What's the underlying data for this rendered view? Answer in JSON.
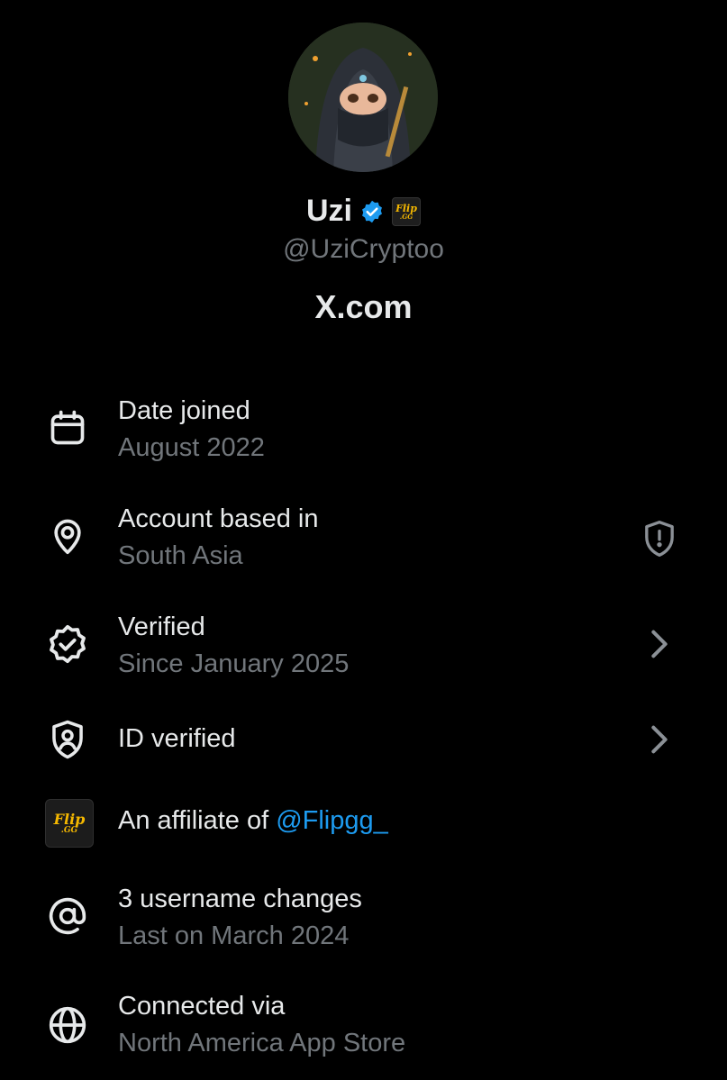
{
  "profile": {
    "display_name": "Uzi",
    "handle": "@UziCryptoo",
    "site": "X.com",
    "affiliate_badge_text": "Flip",
    "affiliate_badge_sub": ".GG",
    "verified_color": "#1d9bf0"
  },
  "rows": {
    "date_joined": {
      "title": "Date joined",
      "subtitle": "August 2022",
      "icon": "calendar-icon"
    },
    "account_based": {
      "title": "Account based in",
      "subtitle": "South Asia",
      "icon": "location-pin-icon",
      "right_icon": "shield-alert-icon"
    },
    "verified": {
      "title": "Verified",
      "subtitle": "Since January 2025",
      "icon": "verified-badge-outline-icon",
      "right_icon": "chevron-right-icon"
    },
    "id_verified": {
      "title": "ID verified",
      "icon": "id-shield-icon",
      "right_icon": "chevron-right-icon"
    },
    "affiliate": {
      "prefix": "An affiliate of ",
      "link": "@Flipgg_",
      "icon_text": "Flip",
      "icon_sub": ".GG"
    },
    "username_changes": {
      "title": "3 username changes",
      "subtitle": "Last on March 2024",
      "icon": "at-sign-icon"
    },
    "connected": {
      "title": "Connected via",
      "subtitle": "North America App Store",
      "icon": "globe-icon"
    }
  },
  "colors": {
    "background": "#000000",
    "primary_text": "#e7e9ea",
    "secondary_text": "#71767b",
    "link": "#1d9bf0",
    "affiliate_gold": "#f5b800"
  }
}
